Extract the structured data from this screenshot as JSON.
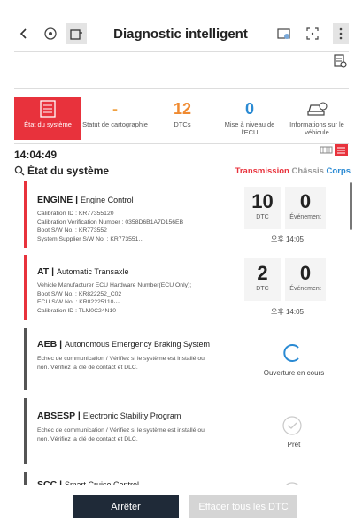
{
  "header": {
    "title": "Diagnostic intelligent",
    "icons": [
      "back-icon",
      "settings-vehicle-icon",
      "scan-tool-icon",
      "car-battery-icon",
      "screen-capture-icon",
      "more-menu-icon",
      "report-icon"
    ]
  },
  "tiles": [
    {
      "label": "État du système",
      "value": "",
      "active": true
    },
    {
      "label": "Statut de cartographie",
      "value": "-",
      "active": false
    },
    {
      "label": "DTCs",
      "value": "12",
      "active": false
    },
    {
      "label": "Mise à niveau de l'ECU",
      "value": "0",
      "active": false
    },
    {
      "label": "Informations sur le véhicule",
      "value": "",
      "active": false
    }
  ],
  "time": "14:04:49",
  "section": {
    "title": "État du système",
    "filters": [
      "Transmission",
      "Châssis",
      "Corps"
    ]
  },
  "cards": [
    {
      "code": "ENGINE",
      "name": "Engine Control",
      "info": [
        "Calibration ID : KR77355120",
        "Calibration Verification Number : 0358D6B1A7D156EB",
        "Boot S/W No. : KR773552",
        "System Supplier S/W No. : KR773551..."
      ],
      "dtc": "10",
      "dtc_label": "DTC",
      "events": "0",
      "events_label": "Événement",
      "timestamp": "오후 14:05"
    },
    {
      "code": "AT",
      "name": "Automatic Transaxle",
      "info": [
        "Vehicle Manufacturer ECU Hardware Number(ECU Only);",
        "Boot S/W No. : KR822252_C02",
        "ECU S/W No. : KR822251​10···",
        "Calibration ID : TLM0C24N10"
      ],
      "dtc": "2",
      "dtc_label": "DTC",
      "events": "0",
      "events_label": "Événement",
      "timestamp": "오후 14:05"
    },
    {
      "code": "AEB",
      "name": "Autonomous Emergency Braking System",
      "info": [
        "Echec de communication / Vérifiez si le système est installé ou",
        "non. Vérifiez la clé de contact et DLC."
      ],
      "status": "Ouverture en cours"
    },
    {
      "code": "ABSESP",
      "name": "Electronic Stability Program",
      "info": [
        "Echec de communication / Vérifiez si le système est installé ou",
        "non. Vérifiez la clé de contact et DLC."
      ],
      "status": "Prêt"
    },
    {
      "code": "SCC",
      "name": "Smart Cruise Control",
      "info": [],
      "status": ""
    }
  ],
  "buttons": {
    "stop": "Arrêter",
    "clear": "Effacer tous les DTC"
  },
  "colors": {
    "accent": "#e8323c",
    "blue": "#2a8ad3",
    "dark_button": "#1f2a38",
    "disabled_button": "#d5d5d5"
  }
}
